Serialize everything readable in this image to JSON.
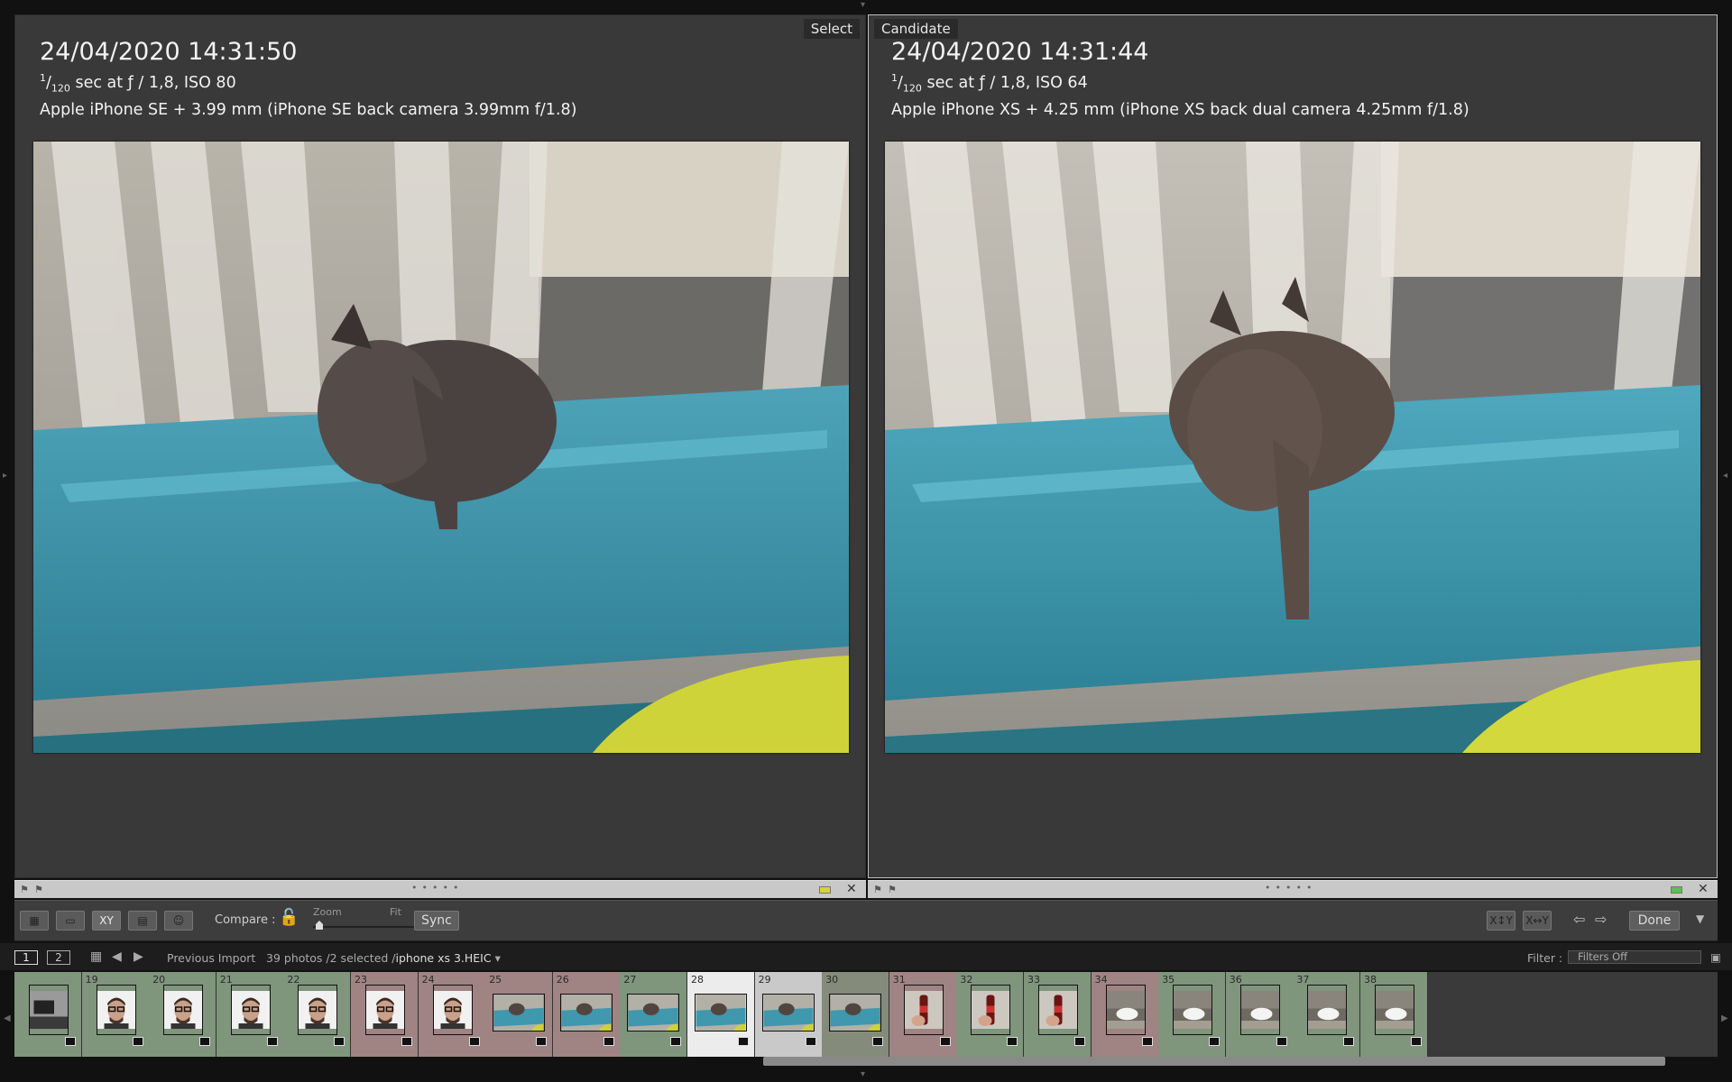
{
  "compare": {
    "select": {
      "badge": "Select",
      "timestamp": "24/04/2020 14:31:50",
      "exposure_num": "1",
      "exposure_den": "120",
      "exposure_rest": " sec at ƒ / 1,8, ISO 80",
      "camera": "Apple iPhone SE + 3.99 mm (iPhone SE back camera 3.99mm f/1.8)",
      "label_color": "#d8d23a"
    },
    "candidate": {
      "badge": "Candidate",
      "timestamp": "24/04/2020 14:31:44",
      "exposure_num": "1",
      "exposure_den": "120",
      "exposure_rest": " sec at ƒ / 1,8, ISO 64",
      "camera": "Apple iPhone XS + 4.25 mm (iPhone XS back dual camera 4.25mm f/1.8)",
      "label_color": "#5cc04a"
    }
  },
  "toolbar": {
    "compare_label": "Compare :",
    "zoom_label": "Zoom",
    "fit_label": "Fit",
    "sync_label": "Sync",
    "done_label": "Done"
  },
  "navbar": {
    "page1": "1",
    "page2": "2",
    "source": "Previous Import",
    "count_text": "39 photos /2 selected /",
    "filename": "iphone xs 3.HEIC",
    "filter_label": "Filter :",
    "filter_value": "Filters Off"
  },
  "filmstrip": {
    "cells": [
      {
        "num": "",
        "type": "tv",
        "color": "#7f957c"
      },
      {
        "num": "19",
        "type": "face",
        "color": "#7f957c"
      },
      {
        "num": "20",
        "type": "face",
        "color": "#7f957c"
      },
      {
        "num": "21",
        "type": "face",
        "color": "#7f957c"
      },
      {
        "num": "22",
        "type": "face",
        "color": "#7f957c"
      },
      {
        "num": "23",
        "type": "face",
        "color": "#a08383"
      },
      {
        "num": "24",
        "type": "face",
        "color": "#a08383"
      },
      {
        "num": "25",
        "type": "cat",
        "color": "#a08383"
      },
      {
        "num": "26",
        "type": "cat",
        "color": "#a08383"
      },
      {
        "num": "27",
        "type": "cat",
        "color": "#7f957c"
      },
      {
        "num": "28",
        "type": "cat",
        "color": "#ececec"
      },
      {
        "num": "29",
        "type": "cat",
        "color": "#c9c9c9"
      },
      {
        "num": "30",
        "type": "cat",
        "color": "#858b7a"
      },
      {
        "num": "31",
        "type": "bottle",
        "color": "#a08383"
      },
      {
        "num": "32",
        "type": "bottle",
        "color": "#7f957c"
      },
      {
        "num": "33",
        "type": "bottle",
        "color": "#7f957c"
      },
      {
        "num": "34",
        "type": "sink",
        "color": "#a08383"
      },
      {
        "num": "35",
        "type": "sink",
        "color": "#7f957c"
      },
      {
        "num": "36",
        "type": "sink",
        "color": "#7f957c"
      },
      {
        "num": "37",
        "type": "sink",
        "color": "#7f957c"
      },
      {
        "num": "38",
        "type": "sink",
        "color": "#7f957c"
      }
    ]
  }
}
